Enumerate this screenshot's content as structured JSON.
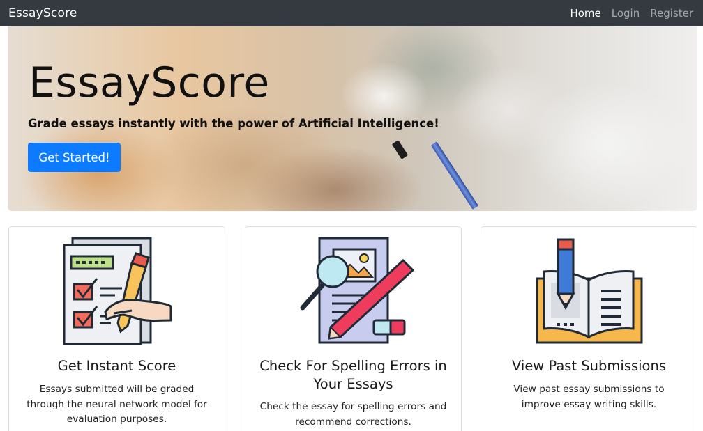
{
  "navbar": {
    "brand": "EssayScore",
    "links": [
      {
        "label": "Home",
        "active": true
      },
      {
        "label": "Login",
        "active": false
      },
      {
        "label": "Register",
        "active": false
      }
    ]
  },
  "hero": {
    "title": "EssayScore",
    "subtitle": "Grade essays instantly with the power of Artificial Intelligence!",
    "button_label": "Get Started!"
  },
  "features": [
    {
      "icon": "checklist-hand-pencil-icon",
      "title": "Get Instant Score",
      "text": "Essays submitted will be graded through the neural network model for evaluation purposes."
    },
    {
      "icon": "document-magnifier-pencil-icon",
      "title": "Check For Spelling Errors in Your Essays",
      "text": "Check the essay for spelling errors and recommend corrections."
    },
    {
      "icon": "open-book-pencil-icon",
      "title": "View Past Submissions",
      "text": "View past essay submissions to improve essay writing skills."
    }
  ],
  "colors": {
    "navbar_bg": "#343a40",
    "primary": "#0d7bff"
  }
}
